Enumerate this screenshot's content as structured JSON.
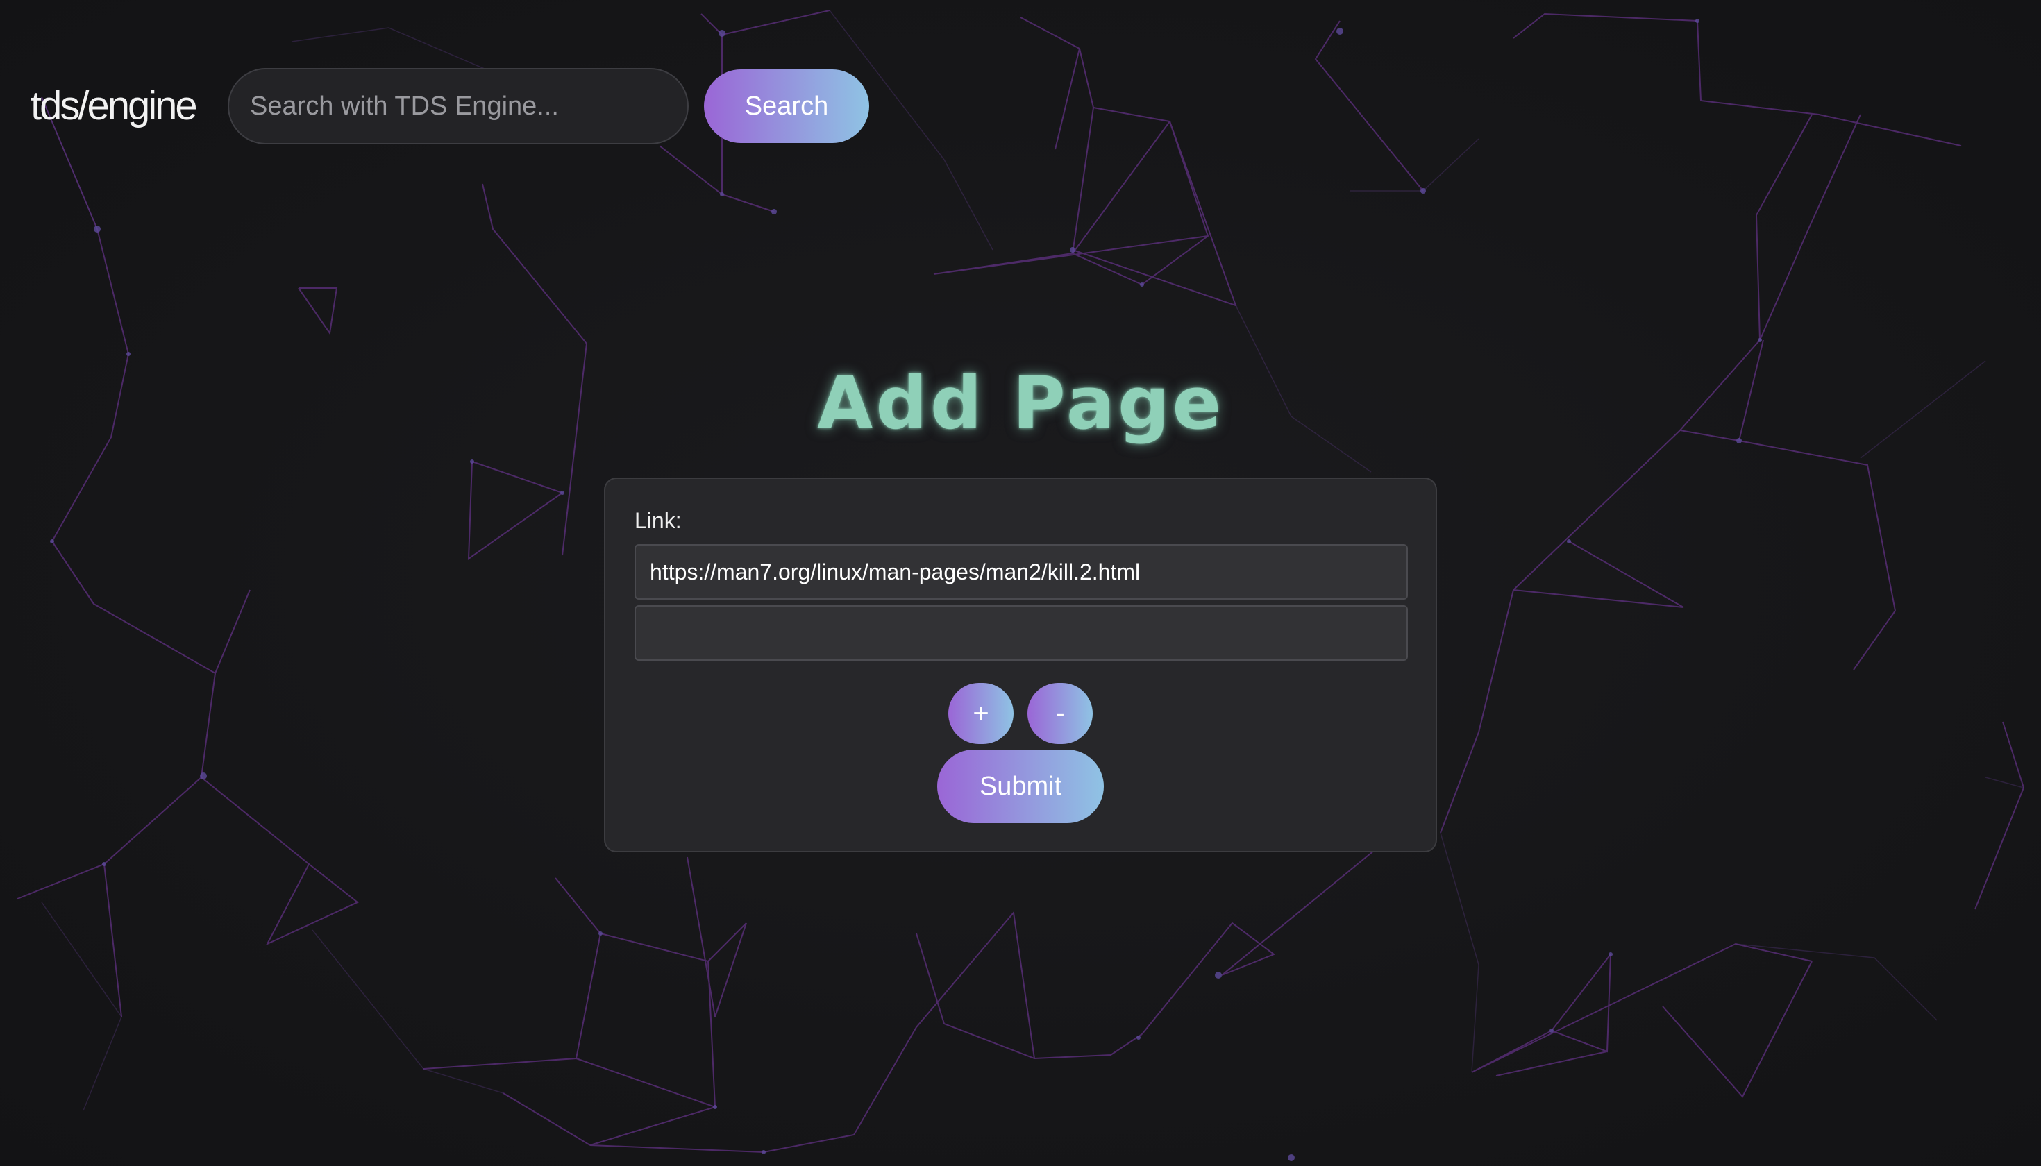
{
  "header": {
    "logo_text": "tds/engine",
    "search_placeholder": "Search with TDS Engine...",
    "search_button_label": "Search"
  },
  "main": {
    "title": "Add Page",
    "form": {
      "link_label": "Link:",
      "links": [
        {
          "value": "https://man7.org/linux/man-pages/man2/kill.2.html"
        },
        {
          "value": ""
        }
      ],
      "add_label": "+",
      "remove_label": "-",
      "submit_label": "Submit"
    }
  },
  "colors": {
    "background": "#161618",
    "card": "#27272a",
    "title": "#8fd0b8",
    "button_gradient_start": "#9a66d6",
    "button_gradient_end": "#8fc3e4",
    "network_lines": "#7a3aa8"
  }
}
